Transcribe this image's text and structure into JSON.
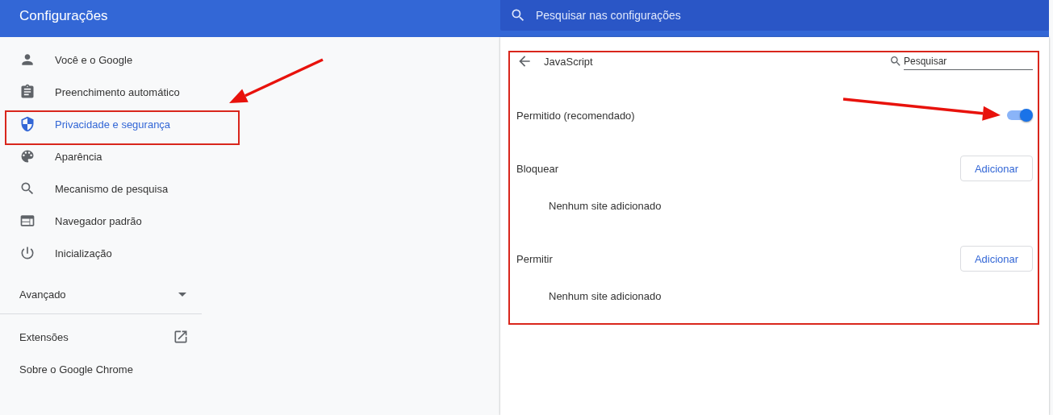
{
  "header": {
    "title": "Configurações",
    "search": {
      "placeholder": "Pesquisar nas configurações"
    }
  },
  "sidebar": {
    "items": [
      {
        "label": "Você e o Google",
        "selected": false,
        "highlighted": false
      },
      {
        "label": "Preenchimento automático",
        "selected": false,
        "highlighted": false
      },
      {
        "label": "Privacidade e segurança",
        "selected": true,
        "highlighted": true
      },
      {
        "label": "Aparência",
        "selected": false,
        "highlighted": false
      },
      {
        "label": "Mecanismo de pesquisa",
        "selected": false,
        "highlighted": false
      },
      {
        "label": "Navegador padrão",
        "selected": false,
        "highlighted": false
      },
      {
        "label": "Inicialização",
        "selected": false,
        "highlighted": false
      }
    ],
    "arrow": true,
    "advanced": {
      "label": "Avançado",
      "expanded": false
    },
    "links": [
      {
        "label": "Extensões",
        "kind": "external"
      },
      {
        "label": "Sobre o Google Chrome",
        "kind": "plain"
      }
    ]
  },
  "panel": {
    "title": "JavaScript",
    "highlighted": true,
    "search": {
      "placeholder": "Pesquisar"
    },
    "setting": {
      "label": "Permitido (recomendado)",
      "on": true,
      "arrow": true
    },
    "sections": [
      {
        "title": "Bloquear",
        "button": "Adicionar",
        "empty": "Nenhum site adicionado"
      },
      {
        "title": "Permitir",
        "button": "Adicionar",
        "empty": "Nenhum site adicionado"
      }
    ]
  }
}
